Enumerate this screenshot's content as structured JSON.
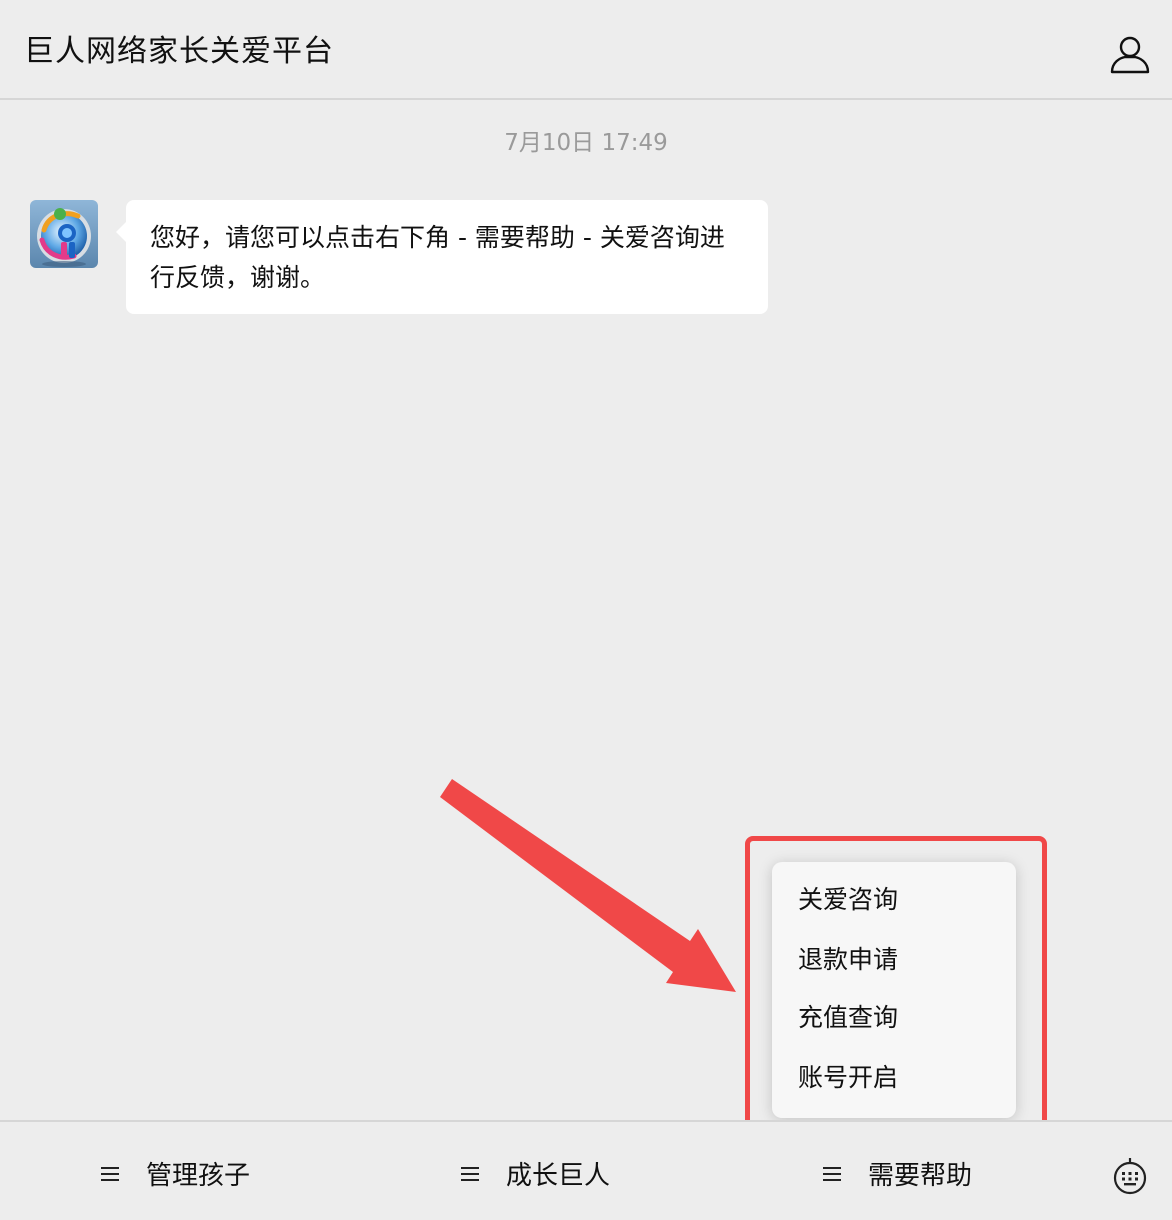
{
  "header": {
    "title": "巨人网络家长关爱平台",
    "profile_icon": "user-profile-icon"
  },
  "chat": {
    "timestamp": "7月10日 17:49",
    "messages": [
      {
        "sender_avatar": "giant-network-logo",
        "text": "您好，请您可以点击右下角 - 需要帮助 - 关爱咨询进行反馈，谢谢。"
      }
    ]
  },
  "popup_menu": {
    "items": [
      {
        "label": "关爱咨询"
      },
      {
        "label": "退款申请"
      },
      {
        "label": "充值查询"
      },
      {
        "label": "账号开启"
      }
    ]
  },
  "annotation": {
    "arrow_color": "#f04848",
    "box_color": "#f04848"
  },
  "bottom_menu": {
    "tabs": [
      {
        "icon": "menu-lines-icon",
        "label": "管理孩子"
      },
      {
        "icon": "menu-lines-icon",
        "label": "成长巨人"
      },
      {
        "icon": "menu-lines-icon",
        "label": "需要帮助"
      }
    ],
    "keyboard_icon": "keyboard-toggle-icon"
  }
}
